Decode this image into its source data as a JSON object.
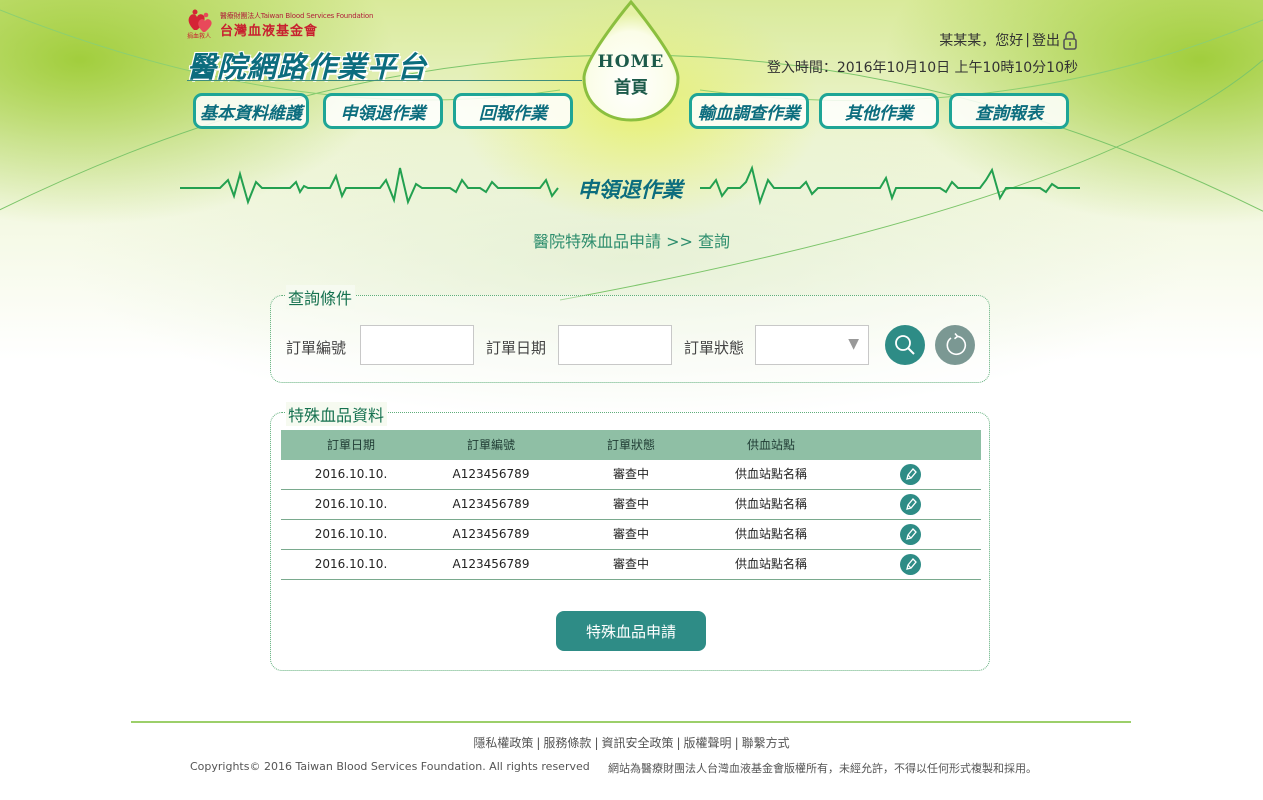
{
  "brand": {
    "logo_small_text": "醫療財團法人Taiwan Blood Services Foundation",
    "logo_name": "台灣血液基金會",
    "logo_tag": "捐血救人",
    "platform_title": "醫院網路作業平台",
    "accent_color": "#1ea596",
    "title_color": "#0c6d7e"
  },
  "home": {
    "label_en": "HOME",
    "label_cn": "首頁"
  },
  "user": {
    "greeting": "某某某，您好",
    "separator": "|",
    "logout": "登出",
    "login_time": "登入時間：2016年10月10日 上午10時10分10秒"
  },
  "nav": {
    "items": [
      {
        "label": "基本資料維護"
      },
      {
        "label": "申領退作業"
      },
      {
        "label": "回報作業"
      },
      {
        "label": "輸血調查作業"
      },
      {
        "label": "其他作業"
      },
      {
        "label": "查詢報表"
      }
    ]
  },
  "section": {
    "title": "申領退作業",
    "breadcrumb": "醫院特殊血品申請 >> 查詢"
  },
  "query": {
    "legend": "查詢條件",
    "order_no_label": "訂單編號",
    "order_no_value": "",
    "order_date_label": "訂單日期",
    "order_date_value": "",
    "order_status_label": "訂單狀態",
    "order_status_value": "",
    "search_icon": "search-icon",
    "reset_icon": "reset-icon"
  },
  "results": {
    "legend": "特殊血品資料",
    "headers": [
      "訂單日期",
      "訂單編號",
      "訂單狀態",
      "供血站點"
    ],
    "rows": [
      [
        "2016.10.10.",
        "A123456789",
        "審查中",
        "供血站點名稱"
      ],
      [
        "2016.10.10.",
        "A123456789",
        "審查中",
        "供血站點名稱"
      ],
      [
        "2016.10.10.",
        "A123456789",
        "審查中",
        "供血站點名稱"
      ],
      [
        "2016.10.10.",
        "A123456789",
        "審查中",
        "供血站點名稱"
      ]
    ],
    "row_action_icon": "edit-pen-icon",
    "apply_button": "特殊血品申請"
  },
  "footer": {
    "links": [
      "隱私權政策",
      "服務條款",
      "資訊安全政策",
      "版權聲明",
      "聯繫方式"
    ],
    "separator": "|",
    "copyright": "Copyrights© 2016 Taiwan Blood Services Foundation. All rights reserved",
    "notice": "網站為醫療財團法人台灣血液基金會版權所有，未經允許，不得以任何形式複製和採用。"
  }
}
